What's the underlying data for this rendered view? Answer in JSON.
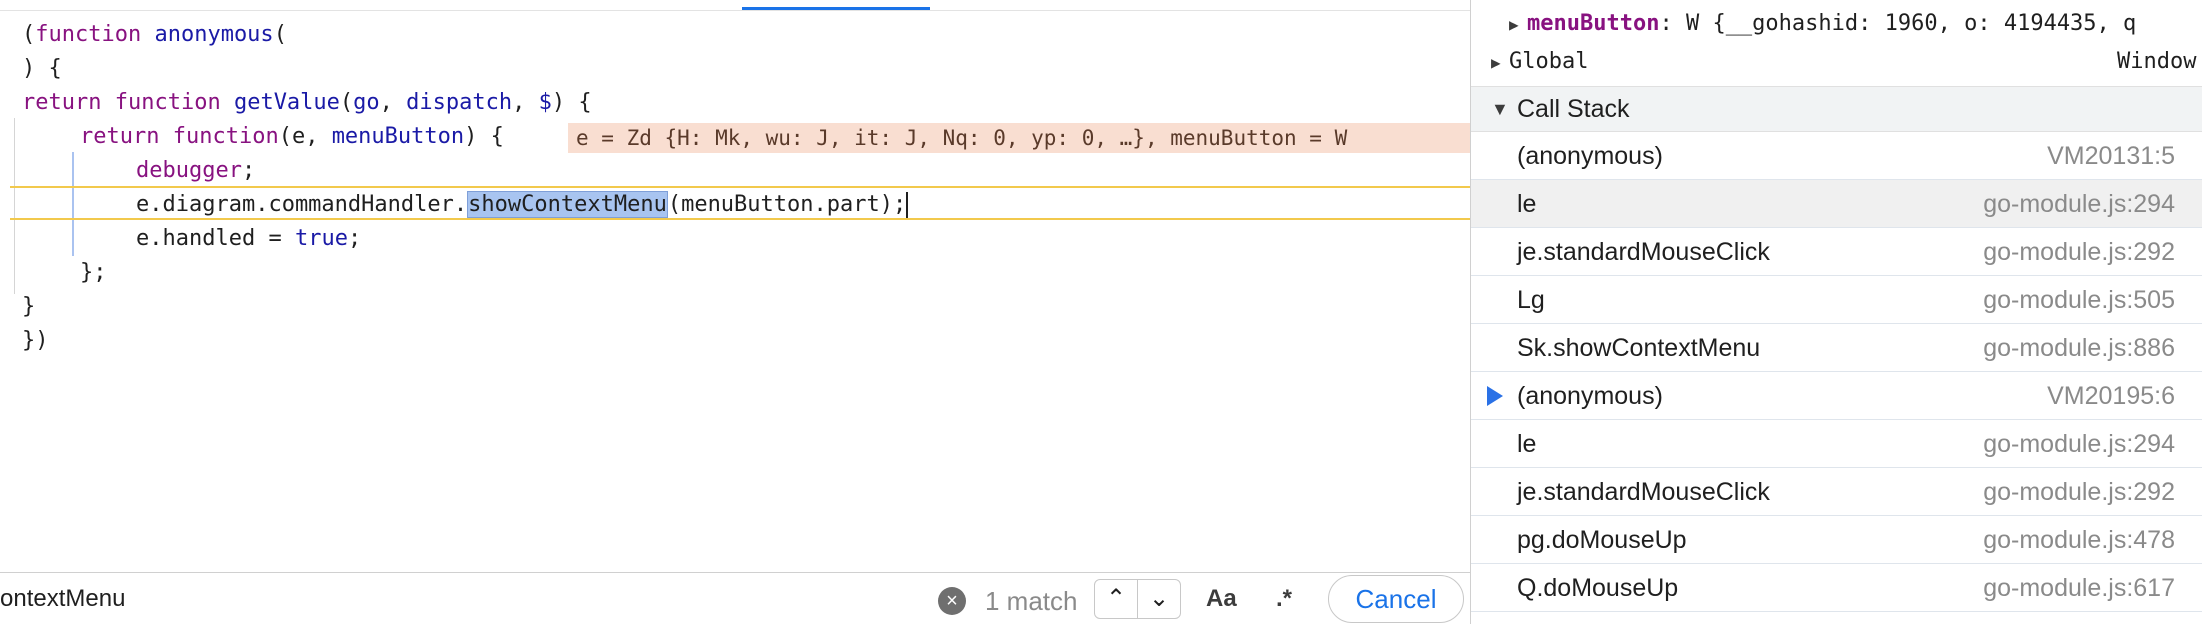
{
  "editor": {
    "lines": [
      {
        "t1": "(",
        "k1": "function",
        "t2": " ",
        "f1": "anonymous",
        "t3": "("
      },
      {
        "t1": ") {"
      },
      {
        "k1": "return",
        "t2": " ",
        "k2": "function",
        "t3": " ",
        "f1": "getValue",
        "t4": "(",
        "v1": "go",
        "t5": ", ",
        "v2": "dispatch",
        "t6": ", ",
        "v3": "$",
        "t7": ") {"
      },
      {
        "k1": "return",
        "t2": " ",
        "k2": "function",
        "t3": "(e, ",
        "v1": "menuButton",
        "t4": ") {"
      },
      {
        "k1": "debugger",
        "t2": ";"
      },
      {
        "pre": "e.diagram.commandHandler.",
        "hl": "showContextMenu",
        "post": "(menuButton.part);"
      },
      {
        "pre": "e.handled = ",
        "kv": "true",
        "post": ";"
      },
      {
        "t1": "};"
      },
      {
        "t1": "}"
      },
      {
        "t1": "})"
      }
    ],
    "inline_values": "e = Zd {H: Mk, wu: J, it: J, Nq: 0, yp: 0, …}, menuButton = W"
  },
  "search": {
    "value": "ontextMenu",
    "match_count": "1 match",
    "prev_glyph": "⌃",
    "next_glyph": "⌄",
    "case_label": "Aa",
    "regex_label": ".*",
    "cancel_label": "Cancel",
    "clear_glyph": "×"
  },
  "scope": {
    "menuButton_key": "menuButton",
    "menuButton_value": "W {__gohashid: 1960, o: 4194435, q",
    "global_label": "Global",
    "global_value": "Window"
  },
  "call_stack": {
    "header": "Call Stack",
    "frames": [
      {
        "name": "(anonymous)",
        "location": "VM20131:5"
      },
      {
        "name": "le",
        "location": "go-module.js:294"
      },
      {
        "name": "je.standardMouseClick",
        "location": "go-module.js:292"
      },
      {
        "name": "Lg",
        "location": "go-module.js:505"
      },
      {
        "name": "Sk.showContextMenu",
        "location": "go-module.js:886"
      },
      {
        "name": "(anonymous)",
        "location": "VM20195:6"
      },
      {
        "name": "le",
        "location": "go-module.js:294"
      },
      {
        "name": "je.standardMouseClick",
        "location": "go-module.js:292"
      },
      {
        "name": "pg.doMouseUp",
        "location": "go-module.js:478"
      },
      {
        "name": "Q.doMouseUp",
        "location": "go-module.js:617"
      }
    ]
  },
  "colors": {
    "accent": "#1a73e8",
    "exec_line": "#f2c94c",
    "inline_bg": "#f9ded1"
  }
}
